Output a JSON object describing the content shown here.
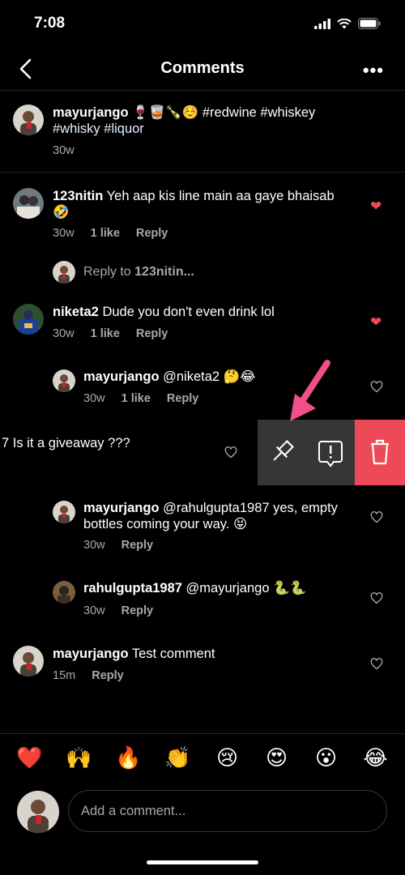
{
  "status_bar": {
    "time": "7:08"
  },
  "header": {
    "title": "Comments",
    "more": "•••"
  },
  "caption": {
    "username": "mayurjango",
    "text_line1": " 🍷🥃🍾☺️ #redwine #whiskey",
    "text_line2": "#whisky #liquor",
    "time": "30w"
  },
  "comments": [
    {
      "username": "123nitin",
      "text": " Yeh aap kis line main aa gaye bhaisab",
      "text_line2": "🤣",
      "time": "30w",
      "likes": "1 like",
      "reply_label": "Reply"
    },
    {
      "reply_prompt_prefix": "Reply to ",
      "reply_prompt_user": "123nitin..."
    },
    {
      "username": "niketa2",
      "text": " Dude you don't even drink lol",
      "time": "30w",
      "likes": "1 like",
      "reply_label": "Reply"
    },
    {
      "username": "mayurjango",
      "text": " @niketa2 🤔😂",
      "time": "30w",
      "likes": "1 like",
      "reply_label": "Reply"
    },
    {
      "text": "7 Is it a giveaway ???"
    },
    {
      "username": "mayurjango",
      "text": " @rahulgupta1987 yes, empty",
      "text_line2": "bottles coming your way. 😝",
      "time": "30w",
      "reply_label": "Reply"
    },
    {
      "username": "rahulgupta1987",
      "text": " @mayurjango 🐍🐍",
      "time": "30w",
      "reply_label": "Reply"
    },
    {
      "username": "mayurjango",
      "text": " Test comment",
      "time": "15m",
      "reply_label": "Reply"
    }
  ],
  "emoji_bar": [
    "❤️",
    "🙌",
    "🔥",
    "👏",
    "😢",
    "😍",
    "😮",
    "😂"
  ],
  "composer": {
    "placeholder": "Add a comment..."
  },
  "colors": {
    "background": "#000000",
    "heart": "#ed4956",
    "delete": "#ed4956",
    "arrow": "#f0508a"
  }
}
